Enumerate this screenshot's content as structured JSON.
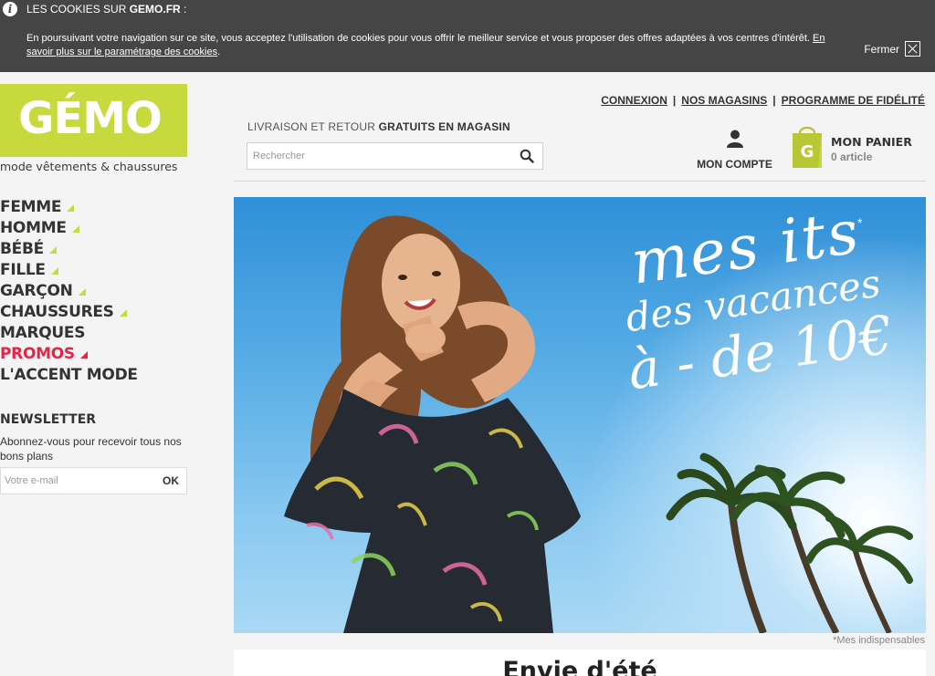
{
  "cookie_banner": {
    "title_prefix": "LES COOKIES SUR ",
    "title_site": "GEMO.FR",
    "title_suffix": " :",
    "text": "En poursuivant votre navigation sur ce site, vous acceptez l'utilisation de cookies pour vous offrir le meilleur service et vous proposer des offres adaptées à vos centres d'intérêt. ",
    "link": "En savoir plus sur le paramétrage des cookies",
    "link_suffix": ".",
    "close_label": "Fermer"
  },
  "brand": {
    "logo_text": "GÉMO",
    "tagline": "mode vêtements & chaussures",
    "logo_color": "#c8d93e"
  },
  "top_links": [
    "CONNEXION",
    "NOS MAGASINS",
    "PROGRAMME DE FIDÉLITÉ"
  ],
  "delivery": {
    "prefix": "LIVRAISON ET RETOUR ",
    "bold": "GRATUITS EN MAGASIN"
  },
  "search": {
    "placeholder": "Rechercher",
    "icon": "search-icon"
  },
  "account": {
    "label": "MON COMPTE",
    "icon": "user-icon"
  },
  "cart": {
    "title": "MON PANIER",
    "count": "0 article",
    "icon": "shopping-bag-icon"
  },
  "menu": [
    {
      "label": "FEMME",
      "arrow": true
    },
    {
      "label": "HOMME",
      "arrow": true
    },
    {
      "label": "BÉBÉ",
      "arrow": true
    },
    {
      "label": "FILLE",
      "arrow": true
    },
    {
      "label": "GARÇON",
      "arrow": true
    },
    {
      "label": "CHAUSSURES",
      "arrow": true
    },
    {
      "label": "MARQUES",
      "arrow": false
    },
    {
      "label": "PROMOS",
      "arrow": true,
      "color": "#e2264a"
    },
    {
      "label": "L'ACCENT MODE",
      "arrow": false
    }
  ],
  "newsletter": {
    "title": "NEWSLETTER",
    "text": "Abonnez-vous pour recevoir tous nos bons plans",
    "placeholder": "Votre e-mail",
    "button": "OK"
  },
  "hero": {
    "line1": "mes its",
    "line2": "des vacances",
    "line3": "à - de 10€",
    "star": "*",
    "footnote": "*Mes indispensables"
  },
  "section": {
    "heading": "Envie d'été"
  }
}
